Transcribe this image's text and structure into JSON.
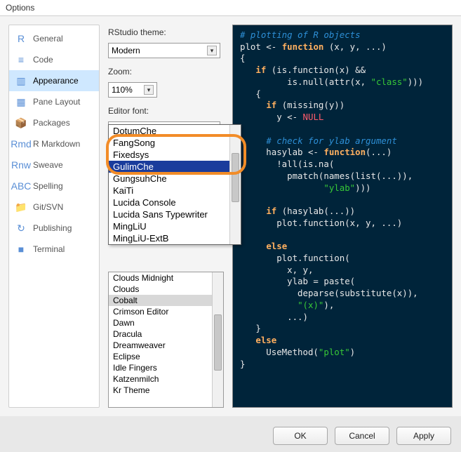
{
  "window_title": "Options",
  "sidebar": {
    "items": [
      {
        "label": "General",
        "icon": "R"
      },
      {
        "label": "Code",
        "icon": "≡"
      },
      {
        "label": "Appearance",
        "icon": "▥",
        "selected": true
      },
      {
        "label": "Pane Layout",
        "icon": "▦"
      },
      {
        "label": "Packages",
        "icon": "📦"
      },
      {
        "label": "R Markdown",
        "icon": "Rmd"
      },
      {
        "label": "Sweave",
        "icon": "Rnw"
      },
      {
        "label": "Spelling",
        "icon": "ABC"
      },
      {
        "label": "Git/SVN",
        "icon": "📁"
      },
      {
        "label": "Publishing",
        "icon": "↻"
      },
      {
        "label": "Terminal",
        "icon": "■"
      }
    ]
  },
  "labels": {
    "theme": "RStudio theme:",
    "zoom": "Zoom:",
    "font": "Editor font:"
  },
  "theme_select": "Modern",
  "zoom_select": "110%",
  "font_select": "Lucida Console",
  "font_popup": [
    "DotumChe",
    "FangSong",
    "Fixedsys",
    "GulimChe",
    "GungsuhChe",
    "KaiTi",
    "Lucida Console",
    "Lucida Sans Typewriter",
    "MingLiU",
    "MingLiU-ExtB"
  ],
  "font_popup_selected": "GulimChe",
  "editor_themes": [
    "Clouds Midnight",
    "Clouds",
    "Cobalt",
    "Crimson Editor",
    "Dawn",
    "Dracula",
    "Dreamweaver",
    "Eclipse",
    "Idle Fingers",
    "Katzenmilch",
    "Kr Theme"
  ],
  "editor_theme_selected": "Cobalt",
  "code_preview_tokens": [
    {
      "t": "# plotting of R objects",
      "c": "cmt",
      "nl": 1
    },
    {
      "t": "plot",
      "c": "fn"
    },
    {
      "t": " <- ",
      "c": "op"
    },
    {
      "t": "function",
      "c": "kw"
    },
    {
      "t": " (x, y, ...)",
      "c": "par",
      "nl": 1
    },
    {
      "t": "{",
      "c": "par",
      "nl": 1
    },
    {
      "t": "   ",
      "c": "par"
    },
    {
      "t": "if",
      "c": "kw"
    },
    {
      "t": " (is.function(x) &&",
      "c": "par",
      "nl": 1
    },
    {
      "t": "         is.null(attr(x, ",
      "c": "par"
    },
    {
      "t": "\"class\"",
      "c": "str"
    },
    {
      "t": ")))",
      "c": "par",
      "nl": 1
    },
    {
      "t": "   {",
      "c": "par",
      "nl": 1
    },
    {
      "t": "     ",
      "c": "par"
    },
    {
      "t": "if",
      "c": "kw"
    },
    {
      "t": " (missing(y))",
      "c": "par",
      "nl": 1
    },
    {
      "t": "       y <- ",
      "c": "par"
    },
    {
      "t": "NULL",
      "c": "null",
      "nl": 1
    },
    {
      "t": "",
      "c": "par",
      "nl": 1
    },
    {
      "t": "     ",
      "c": "par"
    },
    {
      "t": "# check for ylab argument",
      "c": "cmt",
      "nl": 1
    },
    {
      "t": "     hasylab <- ",
      "c": "par"
    },
    {
      "t": "function",
      "c": "kw"
    },
    {
      "t": "(...)",
      "c": "par",
      "nl": 1
    },
    {
      "t": "       !all(is.na(",
      "c": "par",
      "nl": 1
    },
    {
      "t": "         pmatch(names(list(...)),",
      "c": "par",
      "nl": 1
    },
    {
      "t": "                ",
      "c": "par"
    },
    {
      "t": "\"ylab\"",
      "c": "str"
    },
    {
      "t": ")))",
      "c": "par",
      "nl": 1
    },
    {
      "t": "",
      "c": "par",
      "nl": 1
    },
    {
      "t": "     ",
      "c": "par"
    },
    {
      "t": "if",
      "c": "kw"
    },
    {
      "t": " (hasylab(...))",
      "c": "par",
      "nl": 1
    },
    {
      "t": "       plot.function(x, y, ...)",
      "c": "par",
      "nl": 1
    },
    {
      "t": "",
      "c": "par",
      "nl": 1
    },
    {
      "t": "     ",
      "c": "par"
    },
    {
      "t": "else",
      "c": "kw",
      "nl": 1
    },
    {
      "t": "       plot.function(",
      "c": "par",
      "nl": 1
    },
    {
      "t": "         x, y,",
      "c": "par",
      "nl": 1
    },
    {
      "t": "         ylab = paste(",
      "c": "par",
      "nl": 1
    },
    {
      "t": "           deparse(substitute(x)),",
      "c": "par",
      "nl": 1
    },
    {
      "t": "           ",
      "c": "par"
    },
    {
      "t": "\"(x)\"",
      "c": "str"
    },
    {
      "t": "),",
      "c": "par",
      "nl": 1
    },
    {
      "t": "         ...)",
      "c": "par",
      "nl": 1
    },
    {
      "t": "   }",
      "c": "par",
      "nl": 1
    },
    {
      "t": "   ",
      "c": "par"
    },
    {
      "t": "else",
      "c": "kw",
      "nl": 1
    },
    {
      "t": "     UseMethod(",
      "c": "par"
    },
    {
      "t": "\"plot\"",
      "c": "str"
    },
    {
      "t": ")",
      "c": "par",
      "nl": 1
    },
    {
      "t": "}",
      "c": "par"
    }
  ],
  "buttons": {
    "ok": "OK",
    "cancel": "Cancel",
    "apply": "Apply"
  }
}
